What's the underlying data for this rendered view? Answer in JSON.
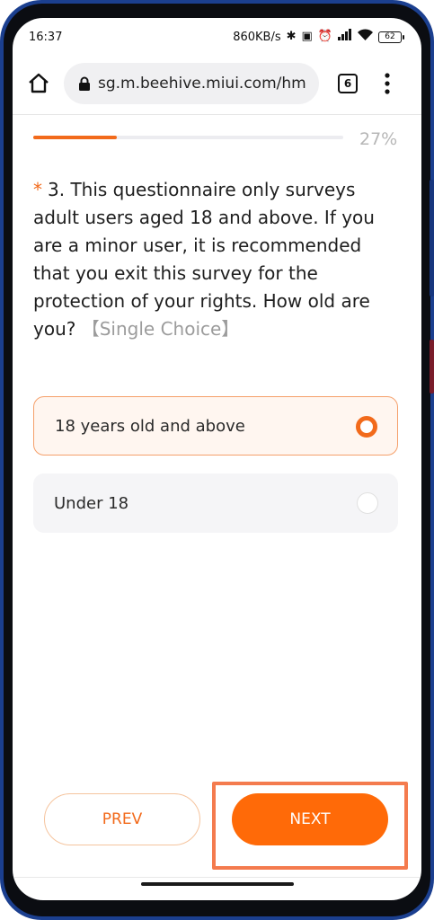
{
  "status_bar": {
    "time": "16:37",
    "network_speed": "860KB/s",
    "battery_level": "62"
  },
  "browser": {
    "url": "sg.m.beehive.miui.com/hm",
    "tabs_count": "6"
  },
  "survey": {
    "progress_label": "27%",
    "progress_fraction": 0.27,
    "question": {
      "required_mark": "*",
      "text": "3. This questionnaire only surveys adult users aged 18 and above. If you are a minor user, it is recommended that you exit this survey for the protection of your rights. How old are you?",
      "type_label": "【Single Choice】"
    },
    "options": [
      {
        "label": "18 years old and above",
        "selected": true
      },
      {
        "label": "Under 18",
        "selected": false
      }
    ]
  },
  "buttons": {
    "prev_label": "PREV",
    "next_label": "NEXT"
  },
  "colors": {
    "accent": "#ff6a08",
    "highlight": "#f47b4e"
  }
}
